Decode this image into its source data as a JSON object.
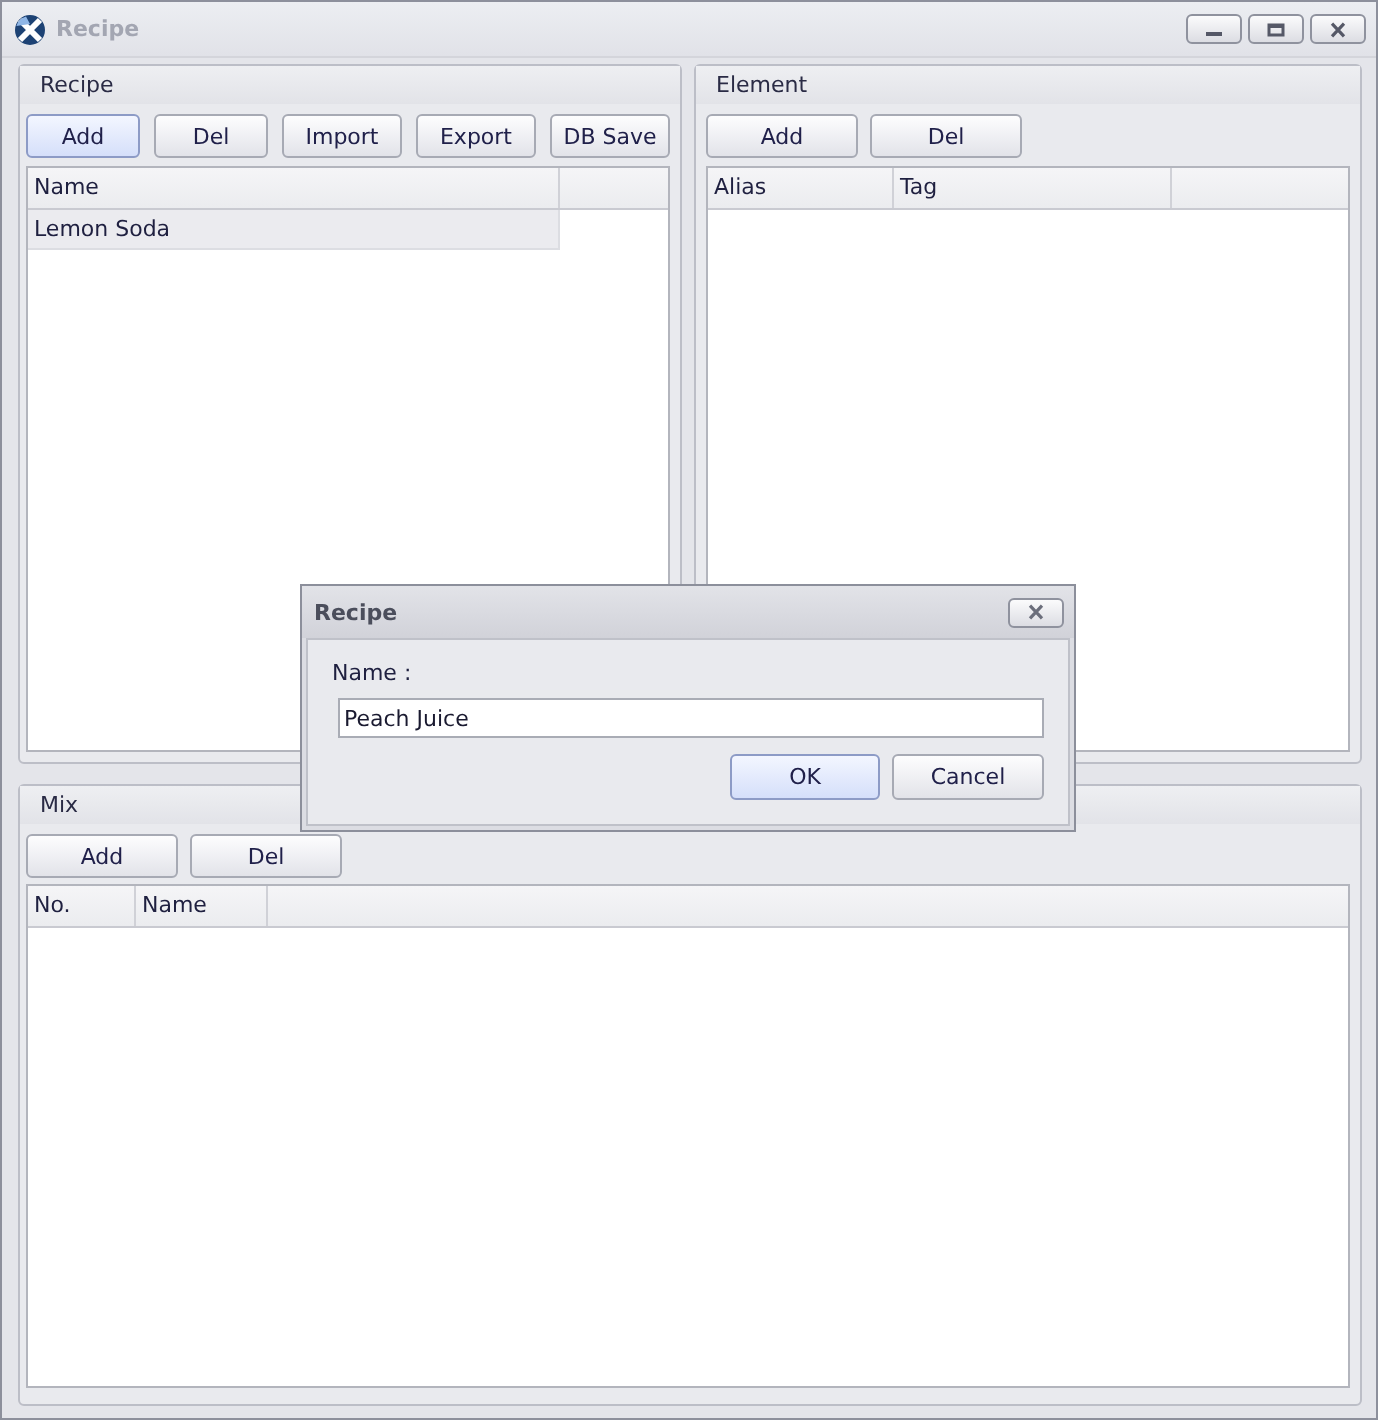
{
  "window": {
    "title": "Recipe",
    "active": false
  },
  "recipe_panel": {
    "title": "Recipe",
    "buttons": [
      {
        "label": "Add",
        "highlighted": true
      },
      {
        "label": "Del",
        "highlighted": false
      },
      {
        "label": "Import",
        "highlighted": false
      },
      {
        "label": "Export",
        "highlighted": false
      },
      {
        "label": "DB Save",
        "highlighted": false
      }
    ],
    "table": {
      "columns": [
        "Name"
      ],
      "rows": [
        {
          "cells": [
            "Lemon Soda"
          ],
          "selected": true
        }
      ]
    }
  },
  "element_panel": {
    "title": "Element",
    "buttons": [
      {
        "label": "Add",
        "highlighted": false
      },
      {
        "label": "Del",
        "highlighted": false
      }
    ],
    "table": {
      "columns": [
        "Alias",
        "Tag"
      ]
    }
  },
  "mix_panel": {
    "title": "Mix",
    "buttons": [
      {
        "label": "Add",
        "highlighted": false
      },
      {
        "label": "Del",
        "highlighted": false
      }
    ],
    "table": {
      "columns": [
        "No.",
        "Name"
      ]
    }
  },
  "dialog": {
    "title": "Recipe",
    "active": true,
    "field": {
      "label": "Name :",
      "value": "Peach Juice"
    },
    "buttons": [
      {
        "label": "OK",
        "highlighted": true
      },
      {
        "label": "Cancel",
        "highlighted": false
      }
    ]
  }
}
